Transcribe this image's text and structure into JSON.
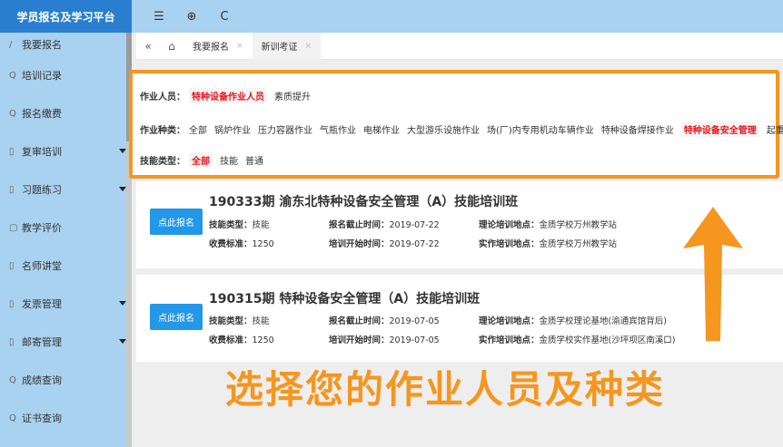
{
  "sidebar": {
    "brand": "学员报名及学习平台",
    "items": [
      {
        "icon": "/",
        "label": "我要报名",
        "has_caret": false
      },
      {
        "icon": "Q",
        "label": "培训记录",
        "has_caret": false
      },
      {
        "icon": "Q",
        "label": "报名缴费",
        "has_caret": false
      },
      {
        "icon": "▯",
        "label": "复审培训",
        "has_caret": true
      },
      {
        "icon": "▯",
        "label": "习题练习",
        "has_caret": true
      },
      {
        "icon": "▢",
        "label": "教学评价",
        "has_caret": false
      },
      {
        "icon": "▯",
        "label": "名师讲堂",
        "has_caret": false
      },
      {
        "icon": "▯",
        "label": "发票管理",
        "has_caret": true
      },
      {
        "icon": "▯",
        "label": "邮寄管理",
        "has_caret": true
      },
      {
        "icon": "Q",
        "label": "成绩查询",
        "has_caret": false
      },
      {
        "icon": "Q",
        "label": "证书查询",
        "has_caret": false
      }
    ]
  },
  "topbar": {
    "menu_icon": "☰",
    "globe_icon": "⊕",
    "refresh_icon": "C"
  },
  "tabs": {
    "back_icon": "«",
    "home_icon": "⌂",
    "items": [
      {
        "label": "我要报名",
        "close": "×"
      },
      {
        "label": "新训考证",
        "close": "×"
      }
    ]
  },
  "filter": {
    "personnel": {
      "label": "作业人员：",
      "options": [
        "特种设备作业人员",
        "素质提升"
      ],
      "selected": "特种设备作业人员"
    },
    "category": {
      "label": "作业种类：",
      "options": [
        "全部",
        "锅炉作业",
        "压力容器作业",
        "气瓶作业",
        "电梯作业",
        "大型游乐设施作业",
        "场(厂)内专用机动车辆作业",
        "特种设备焊接作业",
        "特种设备安全管理",
        "起重机作业"
      ],
      "selected": "特种设备安全管理"
    },
    "skill": {
      "label": "技能类型：",
      "options": [
        "全部",
        "技能",
        "普通"
      ],
      "selected": "全部"
    }
  },
  "courses": [
    {
      "button": "点此报名",
      "title": "190333期 渝东北特种设备安全管理（A）技能培训班",
      "skill_label": "技能类型：",
      "skill": "技能",
      "fee_label": "收费标准：",
      "fee": "1250",
      "deadline_label": "报名截止时间：",
      "deadline": "2019-07-22",
      "start_label": "培训开始时间：",
      "start": "2019-07-22",
      "theory_label": "理论培训地点：",
      "theory": "金质学校万州教学站",
      "practice_label": "实作培训地点：",
      "practice": "金质学校万州教学站"
    },
    {
      "button": "点此报名",
      "title": "190315期 特种设备安全管理（A）技能培训班",
      "skill_label": "技能类型：",
      "skill": "技能",
      "fee_label": "收费标准：",
      "fee": "1250",
      "deadline_label": "报名截止时间：",
      "deadline": "2019-07-05",
      "start_label": "培训开始时间：",
      "start": "2019-07-05",
      "theory_label": "理论培训地点：",
      "theory": "金质学校理论基地(渝通宾馆背后)",
      "practice_label": "实作培训地点：",
      "practice": "金质学校实作基地(沙坪坝区南溪口)"
    }
  ],
  "overlay": {
    "caption": "选择您的作业人员及种类",
    "color": "#f5961f"
  }
}
